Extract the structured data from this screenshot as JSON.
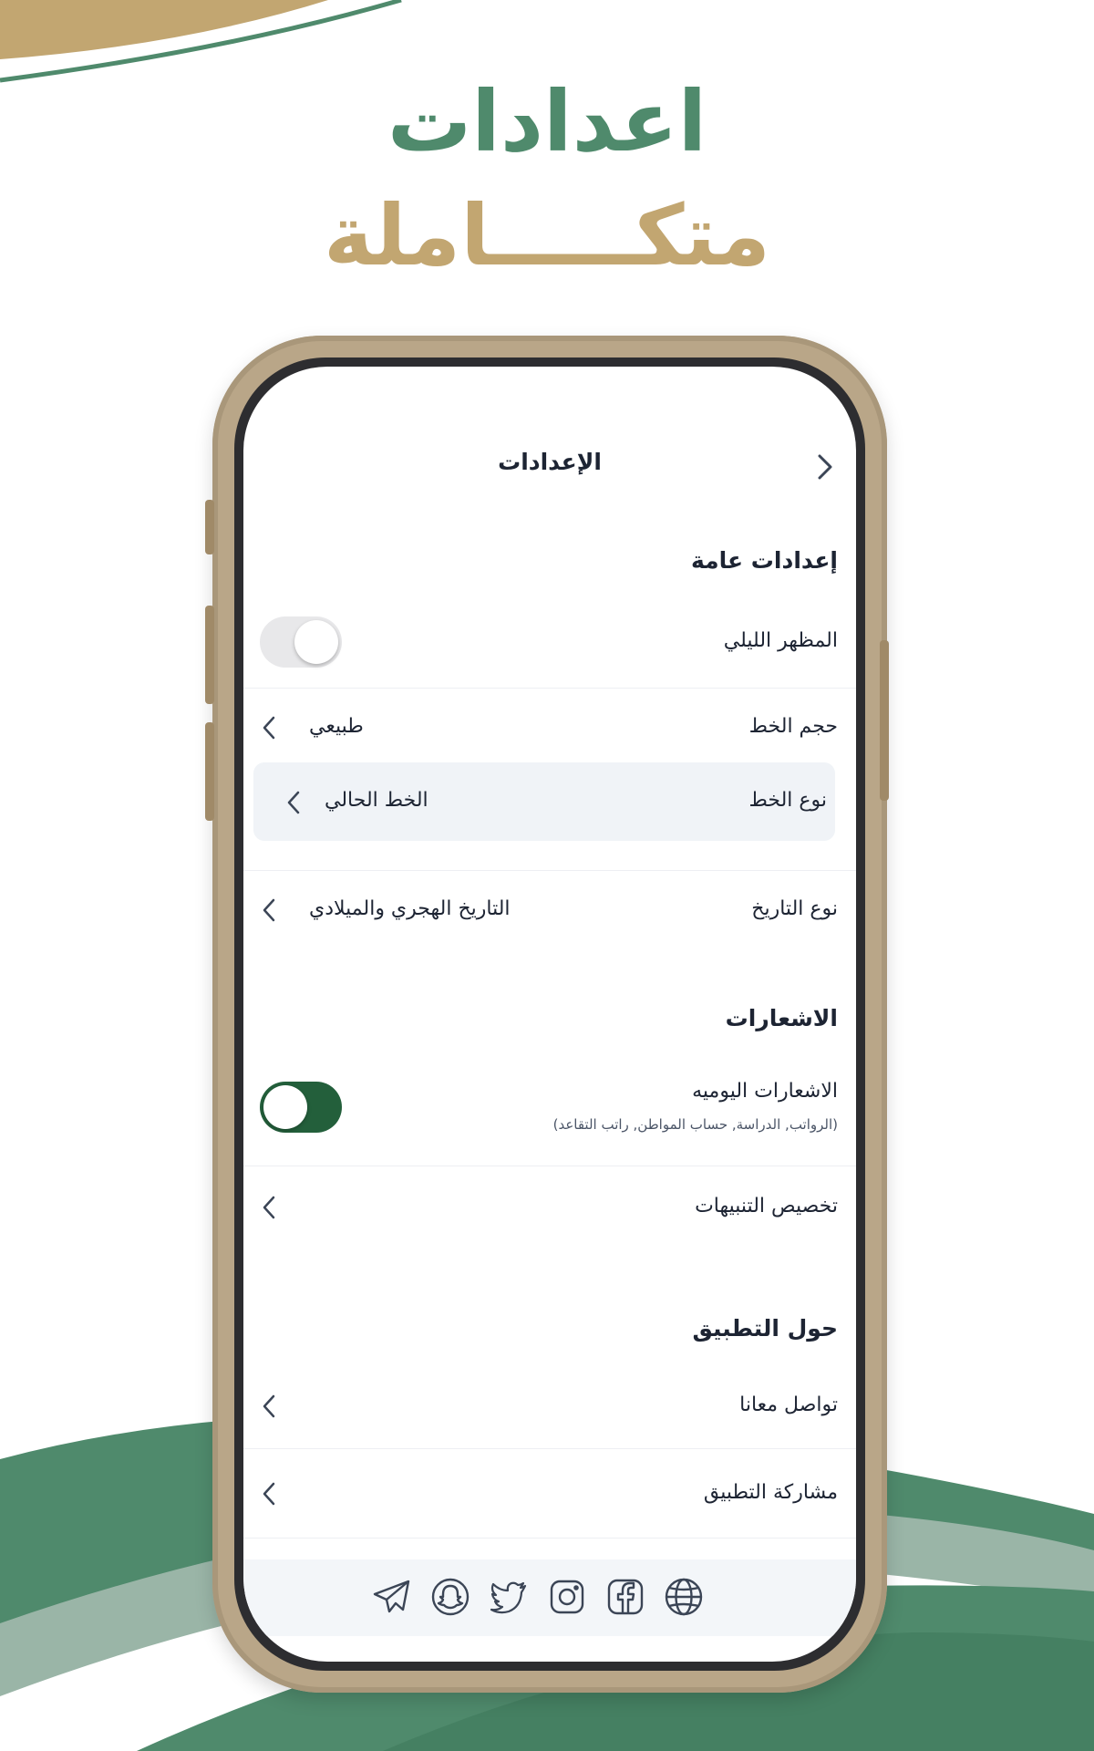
{
  "headline": {
    "line1": "اعدادات",
    "line2": "متكـــــاملة"
  },
  "colors": {
    "green": "#4f8a6c",
    "gold": "#c2a671",
    "toggle_on": "#235f3b",
    "phone_frame": "#b9a688"
  },
  "screen": {
    "title": "الإعدادات",
    "general": {
      "heading": "إعدادات عامة",
      "dark_mode": {
        "label": "المظهر الليلي",
        "enabled": false
      },
      "font_size": {
        "label": "حجم الخط",
        "value": "طبيعي"
      },
      "font_type": {
        "label": "نوع الخط",
        "value": "الخط الحالي"
      },
      "date_type": {
        "label": "نوع التاريخ",
        "value": "التاريخ الهجري والميلادي"
      }
    },
    "notifications": {
      "heading": "الاشعارات",
      "daily": {
        "label": "الاشعارات اليوميه",
        "subtitle": "(الرواتب, الدراسة, حساب المواطن, راتب التقاعد)",
        "enabled": true
      },
      "customize": {
        "label": "تخصيص التنبيهات"
      }
    },
    "about": {
      "heading": "حول التطبيق",
      "contact": {
        "label": "تواصل معانا"
      },
      "share": {
        "label": "مشاركة التطبيق"
      }
    },
    "social_icons": [
      "globe-icon",
      "facebook-icon",
      "instagram-icon",
      "twitter-icon",
      "snapchat-icon",
      "telegram-icon"
    ]
  }
}
